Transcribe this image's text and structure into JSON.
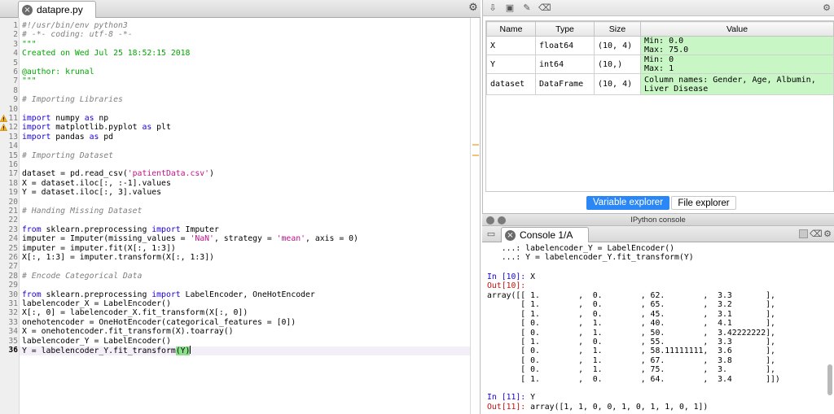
{
  "editor": {
    "tab_label": "datapre.py",
    "current_line": 36,
    "warning_lines": [
      11,
      12
    ],
    "lines": [
      {
        "n": 1,
        "parts": [
          [
            "cm",
            "#!/usr/bin/env python3"
          ]
        ]
      },
      {
        "n": 2,
        "parts": [
          [
            "cm",
            "# -*- coding: utf-8 -*-"
          ]
        ]
      },
      {
        "n": 3,
        "parts": [
          [
            "str",
            "\"\"\""
          ]
        ]
      },
      {
        "n": 4,
        "parts": [
          [
            "str",
            "Created on Wed Jul 25 18:52:15 2018"
          ]
        ]
      },
      {
        "n": 5,
        "parts": []
      },
      {
        "n": 6,
        "parts": [
          [
            "str",
            "@author: krunal"
          ]
        ]
      },
      {
        "n": 7,
        "parts": [
          [
            "str",
            "\"\"\""
          ]
        ]
      },
      {
        "n": 8,
        "parts": []
      },
      {
        "n": 9,
        "parts": [
          [
            "cm",
            "# Importing Libraries"
          ]
        ]
      },
      {
        "n": 10,
        "parts": []
      },
      {
        "n": 11,
        "parts": [
          [
            "kw",
            "import"
          ],
          [
            "",
            " numpy "
          ],
          [
            "kw",
            "as"
          ],
          [
            "",
            " np"
          ]
        ]
      },
      {
        "n": 12,
        "parts": [
          [
            "kw",
            "import"
          ],
          [
            "",
            " matplotlib.pyplot "
          ],
          [
            "kw",
            "as"
          ],
          [
            "",
            " plt"
          ]
        ]
      },
      {
        "n": 13,
        "parts": [
          [
            "kw",
            "import"
          ],
          [
            "",
            " pandas "
          ],
          [
            "kw",
            "as"
          ],
          [
            "",
            " pd"
          ]
        ]
      },
      {
        "n": 14,
        "parts": []
      },
      {
        "n": 15,
        "parts": [
          [
            "cm",
            "# Importing Dataset"
          ]
        ]
      },
      {
        "n": 16,
        "parts": []
      },
      {
        "n": 17,
        "parts": [
          [
            "",
            "dataset = pd.read_csv("
          ],
          [
            "strg",
            "'patientData.csv'"
          ],
          [
            "",
            ")"
          ]
        ]
      },
      {
        "n": 18,
        "parts": [
          [
            "",
            "X = dataset.iloc[:, :-1].values"
          ]
        ]
      },
      {
        "n": 19,
        "parts": [
          [
            "",
            "Y = dataset.iloc[:, 3].values"
          ]
        ]
      },
      {
        "n": 20,
        "parts": []
      },
      {
        "n": 21,
        "parts": [
          [
            "cm",
            "# Handing Missing Dataset"
          ]
        ]
      },
      {
        "n": 22,
        "parts": []
      },
      {
        "n": 23,
        "parts": [
          [
            "kw",
            "from"
          ],
          [
            "",
            " sklearn.preprocessing "
          ],
          [
            "kw",
            "import"
          ],
          [
            "",
            " Imputer"
          ]
        ]
      },
      {
        "n": 24,
        "parts": [
          [
            "",
            "imputer = Imputer(missing_values = "
          ],
          [
            "strg",
            "'NaN'"
          ],
          [
            "",
            ", strategy = "
          ],
          [
            "strg",
            "'mean'"
          ],
          [
            "",
            ", axis = 0)"
          ]
        ]
      },
      {
        "n": 25,
        "parts": [
          [
            "",
            "imputer = imputer.fit(X[:, 1:3])"
          ]
        ]
      },
      {
        "n": 26,
        "parts": [
          [
            "",
            "X[:, 1:3] = imputer.transform(X[:, 1:3])"
          ]
        ]
      },
      {
        "n": 27,
        "parts": []
      },
      {
        "n": 28,
        "parts": [
          [
            "cm",
            "# Encode Categorical Data"
          ]
        ]
      },
      {
        "n": 29,
        "parts": []
      },
      {
        "n": 30,
        "parts": [
          [
            "kw",
            "from"
          ],
          [
            "",
            " sklearn.preprocessing "
          ],
          [
            "kw",
            "import"
          ],
          [
            "",
            " LabelEncoder, OneHotEncoder"
          ]
        ]
      },
      {
        "n": 31,
        "parts": [
          [
            "",
            "labelencoder_X = LabelEncoder()"
          ]
        ]
      },
      {
        "n": 32,
        "parts": [
          [
            "",
            "X[:, 0] = labelencoder_X.fit_transform(X[:, 0])"
          ]
        ]
      },
      {
        "n": 33,
        "parts": [
          [
            "",
            "onehotencoder = OneHotEncoder(categorical_features = [0])"
          ]
        ]
      },
      {
        "n": 34,
        "parts": [
          [
            "",
            "X = onehotencoder.fit_transform(X).toarray()"
          ]
        ]
      },
      {
        "n": 35,
        "parts": [
          [
            "",
            "labelencoder_Y = LabelEncoder()"
          ]
        ]
      },
      {
        "n": 36,
        "parts": [
          [
            "",
            "Y = labelencoder_Y.fit_transform"
          ],
          [
            "hl",
            "(Y)"
          ]
        ]
      }
    ]
  },
  "variable_explorer": {
    "columns": [
      "Name",
      "Type",
      "Size",
      "Value"
    ],
    "rows": [
      {
        "name": "X",
        "type": "float64",
        "size": "(10, 4)",
        "value": [
          "Min: 0.0",
          "Max: 75.0"
        ]
      },
      {
        "name": "Y",
        "type": "int64",
        "size": "(10,)",
        "value": [
          "Min: 0",
          "Max: 1"
        ]
      },
      {
        "name": "dataset",
        "type": "DataFrame",
        "size": "(10, 4)",
        "value": [
          "Column names: Gender, Age, Albumin,",
          "Liver Disease"
        ]
      }
    ],
    "tabs": [
      "Variable explorer",
      "File explorer"
    ],
    "active_tab": "Variable explorer"
  },
  "console": {
    "window_title": "IPython console",
    "tab_label": "Console 1/A",
    "lines": [
      [
        [
          "",
          "   ...: labelencoder_Y = LabelEncoder()"
        ]
      ],
      [
        [
          "",
          "   ...: Y = labelencoder_Y.fit_transform(Y)"
        ]
      ],
      [
        [
          "",
          ""
        ]
      ],
      [
        [
          "in",
          "In [10]: "
        ],
        [
          "",
          "X"
        ]
      ],
      [
        [
          "out",
          "Out[10]:"
        ]
      ],
      [
        [
          "",
          "array([[ 1.        ,  0.        , 62.        ,  3.3       ],"
        ]
      ],
      [
        [
          "",
          "       [ 1.        ,  0.        , 65.        ,  3.2       ],"
        ]
      ],
      [
        [
          "",
          "       [ 1.        ,  0.        , 45.        ,  3.1       ],"
        ]
      ],
      [
        [
          "",
          "       [ 0.        ,  1.        , 40.        ,  4.1       ],"
        ]
      ],
      [
        [
          "",
          "       [ 0.        ,  1.        , 50.        ,  3.42222222],"
        ]
      ],
      [
        [
          "",
          "       [ 1.        ,  0.        , 55.        ,  3.3       ],"
        ]
      ],
      [
        [
          "",
          "       [ 0.        ,  1.        , 58.11111111,  3.6       ],"
        ]
      ],
      [
        [
          "",
          "       [ 0.        ,  1.        , 67.        ,  3.8       ],"
        ]
      ],
      [
        [
          "",
          "       [ 0.        ,  1.        , 75.        ,  3.        ],"
        ]
      ],
      [
        [
          "",
          "       [ 1.        ,  0.        , 64.        ,  3.4       ]])"
        ]
      ],
      [
        [
          "",
          ""
        ]
      ],
      [
        [
          "in",
          "In [11]: "
        ],
        [
          "",
          "Y"
        ]
      ],
      [
        [
          "out",
          "Out[11]: "
        ],
        [
          "",
          "array([1, 1, 0, 0, 1, 0, 1, 1, 0, 1])"
        ]
      ]
    ]
  },
  "icons": {
    "close": "close-icon",
    "options": "gear-icon",
    "warning": "warning-icon"
  },
  "colors": {
    "keyword": "#1a00d8",
    "string_doc": "#00a600",
    "string_literal": "#c0158b",
    "comment": "#7f7f7f",
    "value_cell": "#c8f7c5",
    "active_tab": "#2b86f6",
    "prompt_in": "#1a00d8",
    "prompt_out": "#c01010"
  }
}
